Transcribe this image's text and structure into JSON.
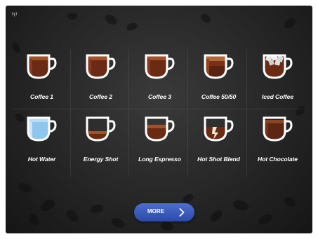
{
  "status_icon": "wifi-signal-icon",
  "drinks": [
    {
      "label": "Coffee 1",
      "style": "full-coffee"
    },
    {
      "label": "Coffee 2",
      "style": "full-coffee"
    },
    {
      "label": "Coffee 3",
      "style": "full-coffee"
    },
    {
      "label": "Coffee 50/50",
      "style": "half-coffee"
    },
    {
      "label": "Iced Coffee",
      "style": "iced-coffee"
    },
    {
      "label": "Hot Water",
      "style": "water"
    },
    {
      "label": "Energy Shot",
      "style": "small-shot"
    },
    {
      "label": "Long Espresso",
      "style": "espresso"
    },
    {
      "label": "Hot Shot Blend",
      "style": "blend"
    },
    {
      "label": "Hot Chocolate",
      "style": "chocolate"
    }
  ],
  "more_button": {
    "label": "MORE",
    "icon": "chevron-right-icon"
  },
  "colors": {
    "button": "#3a5bc0",
    "water": "#8fc6ee",
    "coffee": "#6b2a14"
  }
}
